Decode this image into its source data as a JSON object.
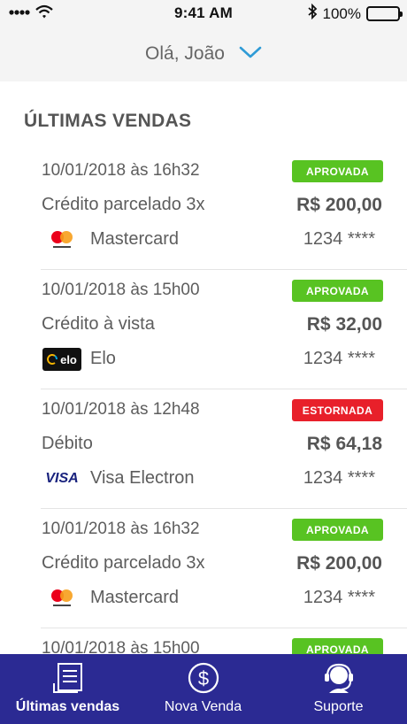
{
  "status_bar": {
    "time": "9:41 AM",
    "battery": "100%"
  },
  "header": {
    "greeting": "Olá, João"
  },
  "section": {
    "title": "ÚLTIMAS VENDAS"
  },
  "colors": {
    "approved": "#58c322",
    "refunded": "#e8202a",
    "tabbar": "#2b2a93",
    "mastercard_red": "#eb001b",
    "mastercard_orange": "#f79e1b"
  },
  "sales": [
    {
      "date": "10/01/2018 às 16h32",
      "status": "APROVADA",
      "type": "Crédito parcelado 3x",
      "amount": "R$ 200,00",
      "brand": "Mastercard",
      "brand_icon": "mastercard-icon",
      "card": "1234 ****"
    },
    {
      "date": "10/01/2018 às 15h00",
      "status": "APROVADA",
      "type": "Crédito à vista",
      "amount": "R$ 32,00",
      "brand": "Elo",
      "brand_icon": "elo-icon",
      "brand_logo_text": "elo",
      "card": "1234 ****"
    },
    {
      "date": "10/01/2018 às 12h48",
      "status": "ESTORNADA",
      "type": "Débito",
      "amount": "R$ 64,18",
      "brand": "Visa Electron",
      "brand_icon": "visa-icon",
      "brand_logo_text": "VISA",
      "card": "1234 ****"
    },
    {
      "date": "10/01/2018 às 16h32",
      "status": "APROVADA",
      "type": "Crédito parcelado 3x",
      "amount": "R$ 200,00",
      "brand": "Mastercard",
      "brand_icon": "mastercard-icon",
      "card": "1234 ****"
    },
    {
      "date": "10/01/2018 às 15h00",
      "status": "APROVADA"
    }
  ],
  "tabs": [
    {
      "label": "Últimas vendas",
      "icon": "receipt-list-icon",
      "active": true
    },
    {
      "label": "Nova Venda",
      "icon": "dollar-circle-icon",
      "active": false
    },
    {
      "label": "Suporte",
      "icon": "headset-icon",
      "active": false
    }
  ]
}
